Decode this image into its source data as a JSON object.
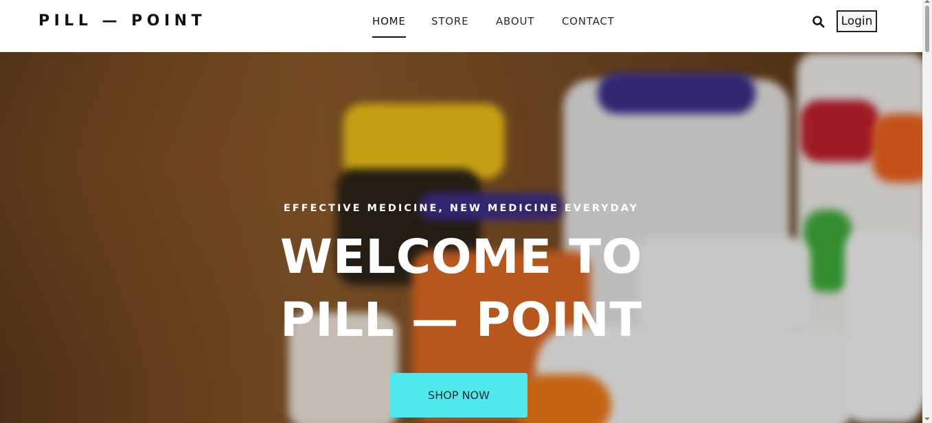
{
  "brand": {
    "name": "PILL — POINT"
  },
  "nav": {
    "items": [
      {
        "label": "HOME",
        "active": true
      },
      {
        "label": "STORE",
        "active": false
      },
      {
        "label": "ABOUT",
        "active": false
      },
      {
        "label": "CONTACT",
        "active": false
      }
    ]
  },
  "header": {
    "search_icon": "search-icon",
    "login_label": "Login"
  },
  "hero": {
    "tagline": "EFFECTIVE MEDICINE, NEW MEDICINE EVERYDAY",
    "headline_line1": "WELCOME TO",
    "headline_line2": "PILL — POINT",
    "cta_label": "SHOP NOW",
    "cta_color": "#4fe8ec"
  }
}
